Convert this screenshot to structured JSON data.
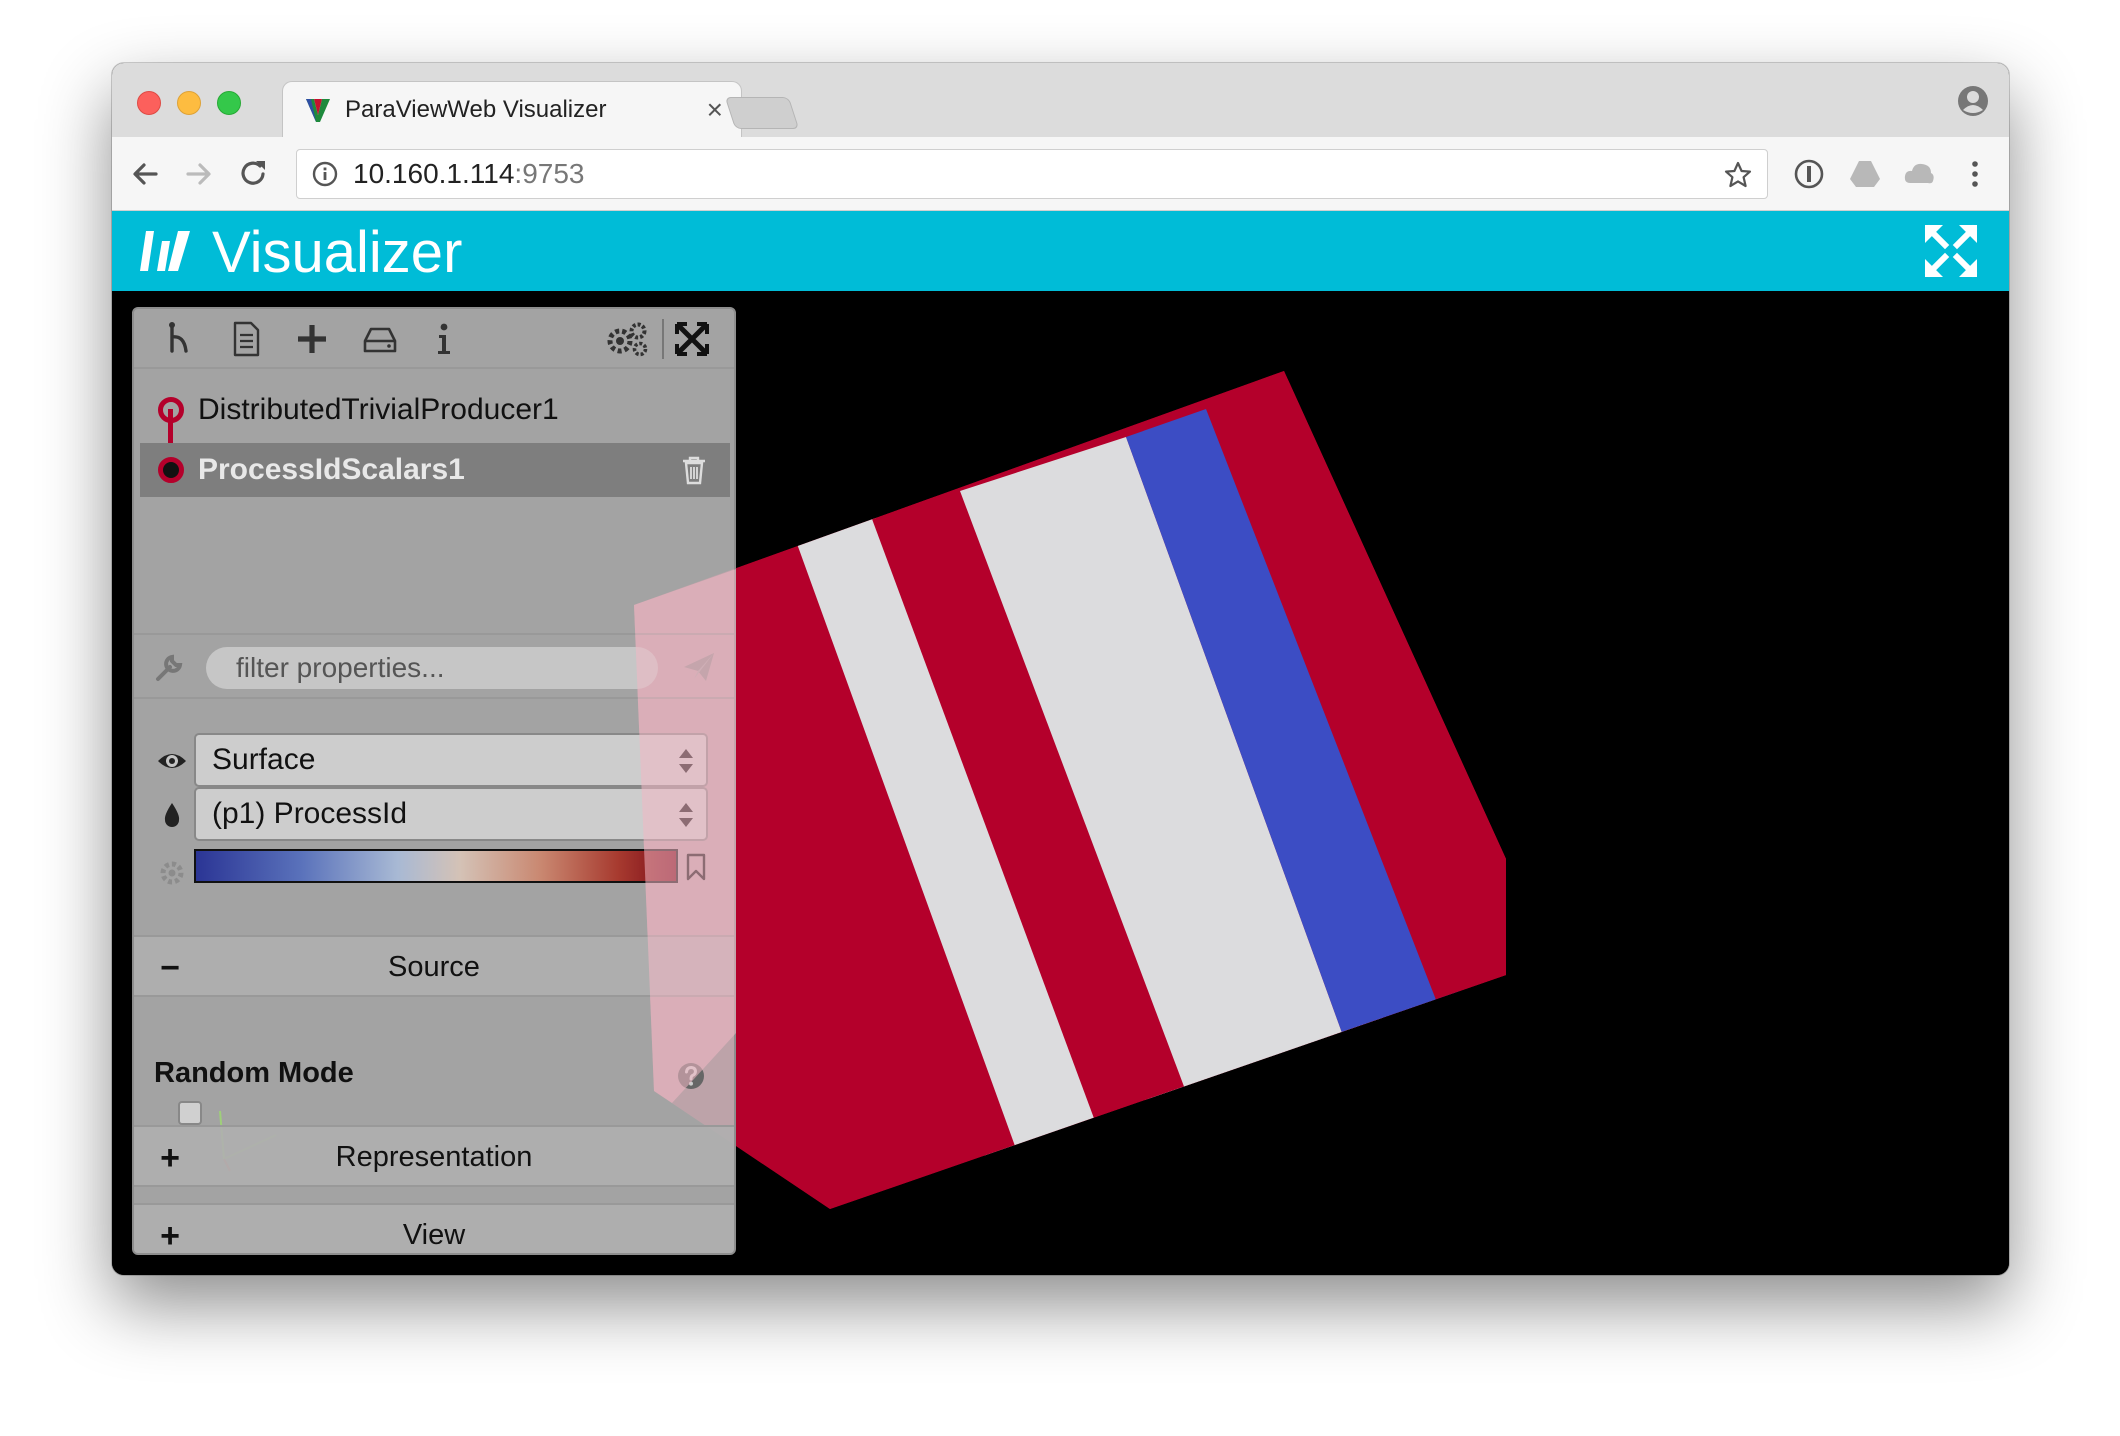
{
  "browser": {
    "tab_title": "ParaViewWeb Visualizer",
    "tab_close": "×",
    "url_host": "10.160.1.114",
    "url_port": ":9753"
  },
  "app": {
    "title": "Visualizer",
    "accent_color": "#00bcd7"
  },
  "panel": {
    "toolbar_icons": [
      "pipeline-icon",
      "document-icon",
      "add-icon",
      "drive-icon",
      "info-icon",
      "settings-icon",
      "collapse-icon"
    ],
    "pipeline": [
      {
        "label": "DistributedTrivialProducer1",
        "selected": false
      },
      {
        "label": "ProcessIdScalars1",
        "selected": true
      }
    ],
    "filter_placeholder": "filter properties...",
    "representation": "Surface",
    "color_by": "(p1) ProcessId",
    "colormap": [
      "#2b3595",
      "#a8b9d4",
      "#d4c2b6",
      "#a73a2f",
      "#7a0a18"
    ],
    "sections": [
      {
        "toggle": "−",
        "label": "Source",
        "expanded": true
      },
      {
        "toggle": "+",
        "label": "Representation",
        "expanded": false
      },
      {
        "toggle": "+",
        "label": "View",
        "expanded": false
      }
    ],
    "random_mode_label": "Random Mode",
    "random_mode_checked": false
  },
  "scene": {
    "background": "#000000",
    "colors": {
      "red": "#b4002b",
      "white": "#dcdcde",
      "blue": "#3c4dc4"
    }
  }
}
